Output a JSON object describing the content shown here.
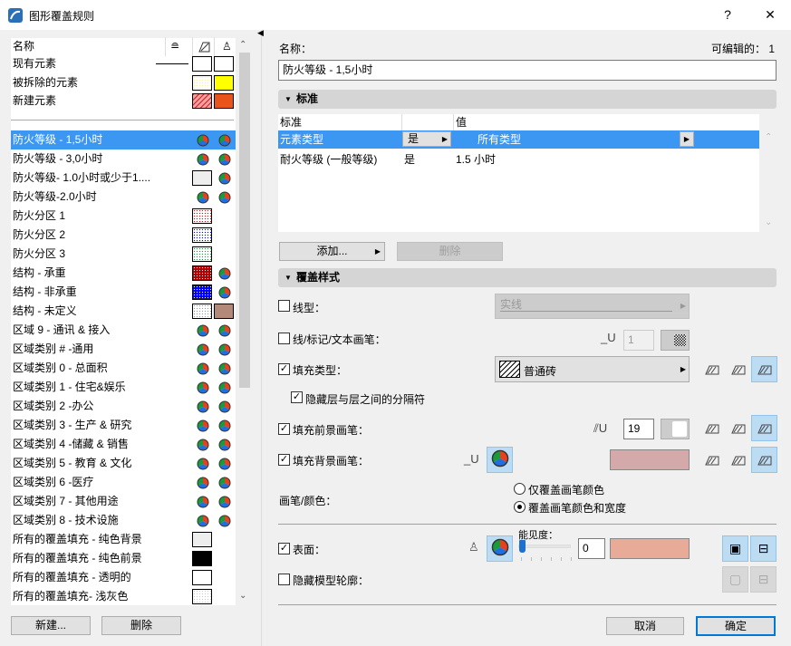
{
  "window": {
    "title": "图形覆盖规则",
    "help": "?",
    "close": "✕"
  },
  "list": {
    "header": {
      "name": "名称"
    },
    "fixed": [
      {
        "label": "现有元素",
        "c1": {
          "type": "line"
        },
        "c2": {
          "type": "swatch",
          "color": "#ffffff"
        },
        "c3": {
          "type": "swatch",
          "color": "#ffffff"
        }
      },
      {
        "label": "被拆除的元素",
        "c2": {
          "type": "swatch",
          "color": "#fff58c",
          "pattern": "dots"
        },
        "c3": {
          "type": "swatch",
          "color": "#ffff00"
        }
      },
      {
        "label": "新建元素",
        "c2": {
          "type": "swatch",
          "color": "#f7a0a0",
          "pattern": "hatch"
        },
        "c3": {
          "type": "swatch",
          "color": "#e8541a"
        }
      }
    ],
    "items": [
      {
        "label": "防火等级 - 1,5小时",
        "c1": {
          "type": "pie"
        },
        "c2": {
          "type": "pie"
        },
        "selected": true
      },
      {
        "label": "防火等级 - 3,0小时",
        "c1": {
          "type": "pie"
        },
        "c2": {
          "type": "pie"
        }
      },
      {
        "label": "防火等级- 1.0小时或少于1....",
        "c1": {
          "type": "swatch",
          "color": "#eeeeee"
        },
        "c2": {
          "type": "pie"
        }
      },
      {
        "label": "防火等级-2.0小时",
        "c1": {
          "type": "pie"
        },
        "c2": {
          "type": "pie"
        }
      },
      {
        "label": "防火分区 1",
        "c1": {
          "type": "swatch",
          "color": "#ff0000",
          "pattern": "dots"
        }
      },
      {
        "label": "防火分区 2",
        "c1": {
          "type": "swatch",
          "color": "#0000ff",
          "pattern": "dots"
        }
      },
      {
        "label": "防火分区 3",
        "c1": {
          "type": "swatch",
          "color": "#1a9a3a",
          "pattern": "dots"
        }
      },
      {
        "label": "结构 - 承重",
        "c1": {
          "type": "swatch",
          "color": "#b00000",
          "pattern": "dense"
        },
        "c2": {
          "type": "pie"
        }
      },
      {
        "label": "结构 - 非承重",
        "c1": {
          "type": "swatch",
          "color": "#0000ff",
          "pattern": "dense"
        },
        "c2": {
          "type": "pie"
        }
      },
      {
        "label": "结构 - 未定义",
        "c1": {
          "type": "swatch",
          "color": "#999999",
          "pattern": "dots"
        },
        "c2": {
          "type": "swatch",
          "color": "#b38a7a"
        }
      },
      {
        "label": "区域 9 - 通讯 & 接入",
        "c1": {
          "type": "pie"
        },
        "c2": {
          "type": "pie"
        }
      },
      {
        "label": "区域类别 # -通用",
        "c1": {
          "type": "pie"
        },
        "c2": {
          "type": "pie"
        }
      },
      {
        "label": "区域类别 0 - 总面积",
        "c1": {
          "type": "pie"
        },
        "c2": {
          "type": "pie"
        }
      },
      {
        "label": "区域类别 1 - 住宅&娱乐",
        "c1": {
          "type": "pie"
        },
        "c2": {
          "type": "pie"
        }
      },
      {
        "label": "区域类别 2 -办公",
        "c1": {
          "type": "pie"
        },
        "c2": {
          "type": "pie"
        }
      },
      {
        "label": "区域类别 3 - 生产 & 研究",
        "c1": {
          "type": "pie"
        },
        "c2": {
          "type": "pie"
        }
      },
      {
        "label": "区域类别 4 -储藏 & 销售",
        "c1": {
          "type": "pie"
        },
        "c2": {
          "type": "pie"
        }
      },
      {
        "label": "区域类别 5 - 教育 & 文化",
        "c1": {
          "type": "pie"
        },
        "c2": {
          "type": "pie"
        }
      },
      {
        "label": "区域类别 6 -医疗",
        "c1": {
          "type": "pie"
        },
        "c2": {
          "type": "pie"
        }
      },
      {
        "label": "区域类别 7 - 其他用途",
        "c1": {
          "type": "pie"
        },
        "c2": {
          "type": "pie"
        }
      },
      {
        "label": "区域类别 8 - 技术设施",
        "c1": {
          "type": "pie"
        },
        "c2": {
          "type": "pie"
        }
      },
      {
        "label": "所有的覆盖填充 - 纯色背景",
        "c1": {
          "type": "swatch",
          "color": "#eeeeee"
        }
      },
      {
        "label": "所有的覆盖填充 - 纯色前景",
        "c1": {
          "type": "swatch",
          "color": "#000000"
        }
      },
      {
        "label": "所有的覆盖填充 - 透明的",
        "c1": {
          "type": "swatch",
          "color": "#ffffff"
        }
      },
      {
        "label": "所有的覆盖填充- 浅灰色",
        "c1": {
          "type": "swatch",
          "color": "#cccccc",
          "pattern": "dots"
        }
      }
    ],
    "new_button": "新建...",
    "delete_button": "删除"
  },
  "detail": {
    "name_label": "名称：",
    "editable_label": "可编辑的：",
    "editable_count": "1",
    "name_value": "防火等级 - 1,5小时",
    "criteria": {
      "title": "标准",
      "col1": "标准",
      "col3": "值",
      "rows": [
        {
          "criterion": "元素类型",
          "op": "是",
          "value": "所有类型"
        },
        {
          "criterion": "耐火等级 (一般等级)",
          "op": "是",
          "value": "1.5 小时"
        }
      ],
      "add_button": "添加...",
      "delete_button": "删除"
    },
    "style": {
      "title": "覆盖样式",
      "line_type": {
        "label": "线型：",
        "checked": false,
        "value": "实线"
      },
      "line_pen": {
        "label": "线/标记/文本画笔：",
        "checked": false,
        "value": "1"
      },
      "fill_type": {
        "label": "填充类型：",
        "checked": true,
        "value": "普通砖"
      },
      "hide_separator": {
        "label": "隐藏层与层之间的分隔符",
        "checked": true
      },
      "fill_fg_pen": {
        "label": "填充前景画笔：",
        "checked": true,
        "value": "19"
      },
      "fill_bg_pen": {
        "label": "填充背景画笔：",
        "checked": true,
        "color": "#d4a9a9"
      },
      "pen_color": {
        "label": "画笔/颜色：",
        "options": [
          "仅覆盖画笔颜色",
          "覆盖画笔颜色和宽度"
        ],
        "selected": 1
      },
      "surface": {
        "label": "表面：",
        "checked": true,
        "visibility_label": "能见度：",
        "visibility": 0,
        "value": "0",
        "color": "#e8ab98"
      },
      "hide_contour": {
        "label": "隐藏模型轮廓：",
        "checked": false
      }
    },
    "cancel_button": "取消",
    "ok_button": "确定"
  }
}
